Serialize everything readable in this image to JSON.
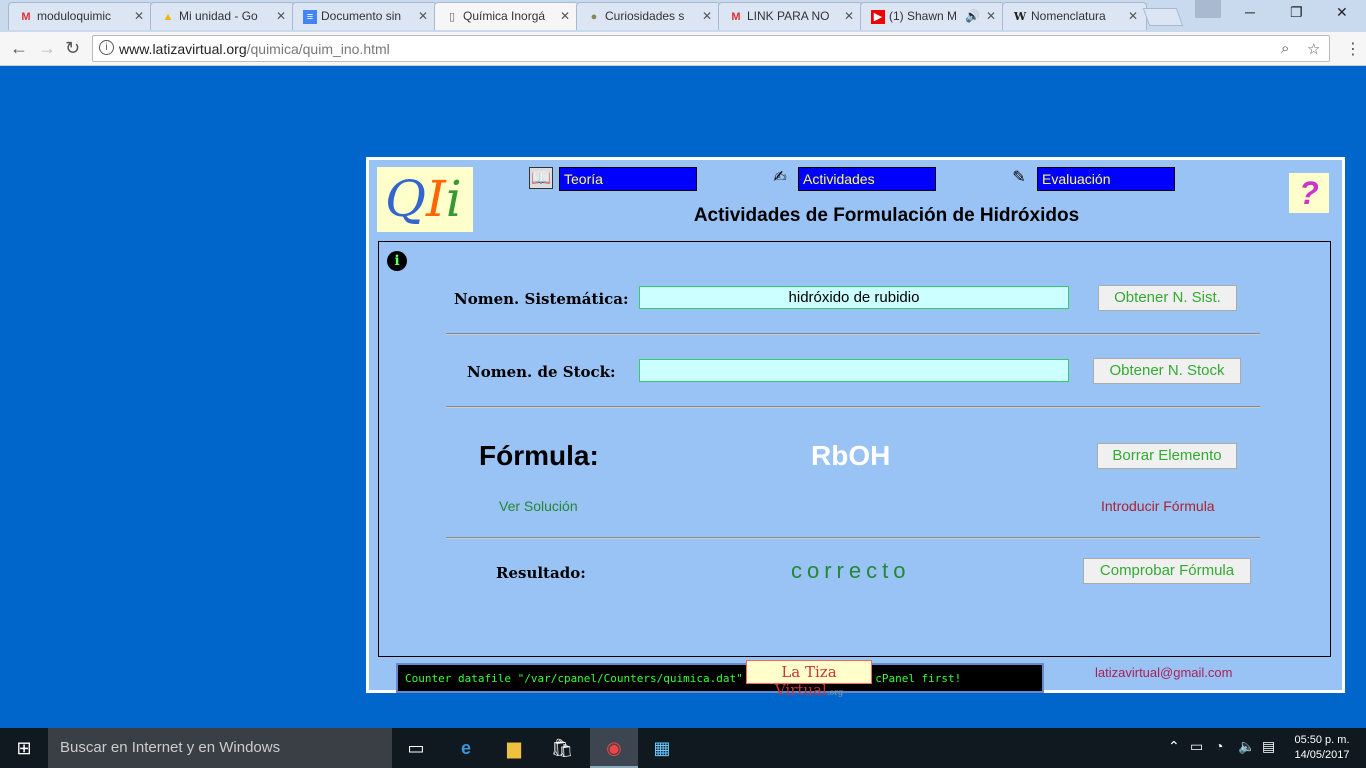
{
  "browser": {
    "tabs": [
      {
        "label": "moduloquimic",
        "icon": "gmail-icon"
      },
      {
        "label": "Mi unidad - Go",
        "icon": "drive-icon"
      },
      {
        "label": "Documento sin",
        "icon": "docs-icon"
      },
      {
        "label": "Química Inorgá",
        "icon": "page-icon"
      },
      {
        "label": "Curiosidades s",
        "icon": "owl-icon"
      },
      {
        "label": "LINK PARA NO",
        "icon": "gmail-icon"
      },
      {
        "label": "(1) Shawn M",
        "icon": "youtube-icon"
      },
      {
        "label": "Nomenclatura",
        "icon": "wikipedia-icon"
      }
    ],
    "active_tab": 3,
    "url_host": "www.latizavirtual.org",
    "url_path": "/quimica/quim_ino.html"
  },
  "page": {
    "nav": {
      "teoria": "Teoría",
      "actividades": "Actividades",
      "evaluacion": "Evaluación"
    },
    "title": "Actividades de Formulación de Hidróxidos",
    "help_symbol": "?",
    "info_symbol": "i",
    "logo": {
      "q": "Q",
      "i1": "I",
      "i2": "i"
    },
    "sistematica": {
      "label": "Nomen. Sistemática:",
      "value": "hidróxido de rubidio",
      "button": "Obtener N. Sist."
    },
    "stock": {
      "label": "Nomen. de Stock:",
      "value": "",
      "button": "Obtener N. Stock"
    },
    "formula": {
      "label": "Fórmula:",
      "value": "RbOH",
      "button": "Borrar Elemento",
      "ver_solucion": "Ver Solución",
      "introducir": "Introducir Fórmula"
    },
    "resultado": {
      "label": "Resultado:",
      "value": "correcto",
      "button": "Comprobar Fórmula"
    },
    "counter_text": "Counter datafile \"/var/cpanel/Counters/quimica.dat\" must be created in cPanel first!",
    "tiza_label": "La Tiza Virtual",
    "tiza_suffix": ".org",
    "email": "latizavirtual@gmail.com"
  },
  "taskbar": {
    "search_placeholder": "Buscar en Internet y en Windows",
    "time": "05:50 p. m.",
    "date": "14/05/2017"
  }
}
